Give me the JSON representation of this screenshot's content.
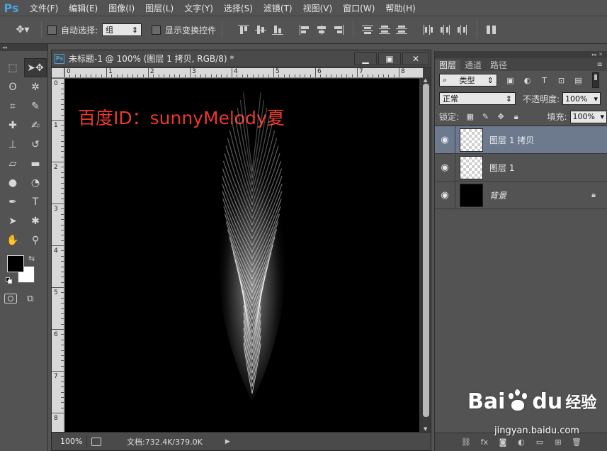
{
  "app": {
    "logo": "Ps"
  },
  "menu": [
    "文件(F)",
    "编辑(E)",
    "图像(I)",
    "图层(L)",
    "文字(Y)",
    "选择(S)",
    "滤镜(T)",
    "视图(V)",
    "窗口(W)",
    "帮助(H)"
  ],
  "options": {
    "auto_select_label": "自动选择:",
    "auto_select_value": "组",
    "show_transform_label": "显示变换控件"
  },
  "document": {
    "title": "未标题-1 @ 100% (图层 1 拷贝, RGB/8) *",
    "ruler_h": [
      "0",
      "1",
      "2",
      "3",
      "4",
      "5",
      "6",
      "7",
      "8"
    ],
    "ruler_v": [
      "0",
      "1",
      "2",
      "3",
      "4",
      "5",
      "6",
      "7",
      "8"
    ],
    "watermark_text": "百度ID：sunnyMelody夏",
    "zoom": "100%",
    "doc_size": "文档:732.4K/379.0K"
  },
  "layers_panel": {
    "tabs": [
      "图层",
      "通道",
      "路径"
    ],
    "filter_label": "类型",
    "blend_mode": "正常",
    "opacity_label": "不透明度:",
    "opacity_value": "100%",
    "lock_label": "锁定:",
    "fill_label": "填充:",
    "fill_value": "100%",
    "layers": [
      {
        "name": "图层 1 拷贝",
        "selected": true
      },
      {
        "name": "图层 1",
        "selected": false
      },
      {
        "name": "背景",
        "selected": false,
        "locked": true
      }
    ]
  },
  "watermark": {
    "brand": "Bai",
    "brand2": "du",
    "product": "经验",
    "url": "jingyan.baidu.com"
  },
  "colors": {
    "accent": "#4aa3df",
    "selected_layer": "#6d7a8e",
    "watermark_red": "#e83a2c"
  }
}
